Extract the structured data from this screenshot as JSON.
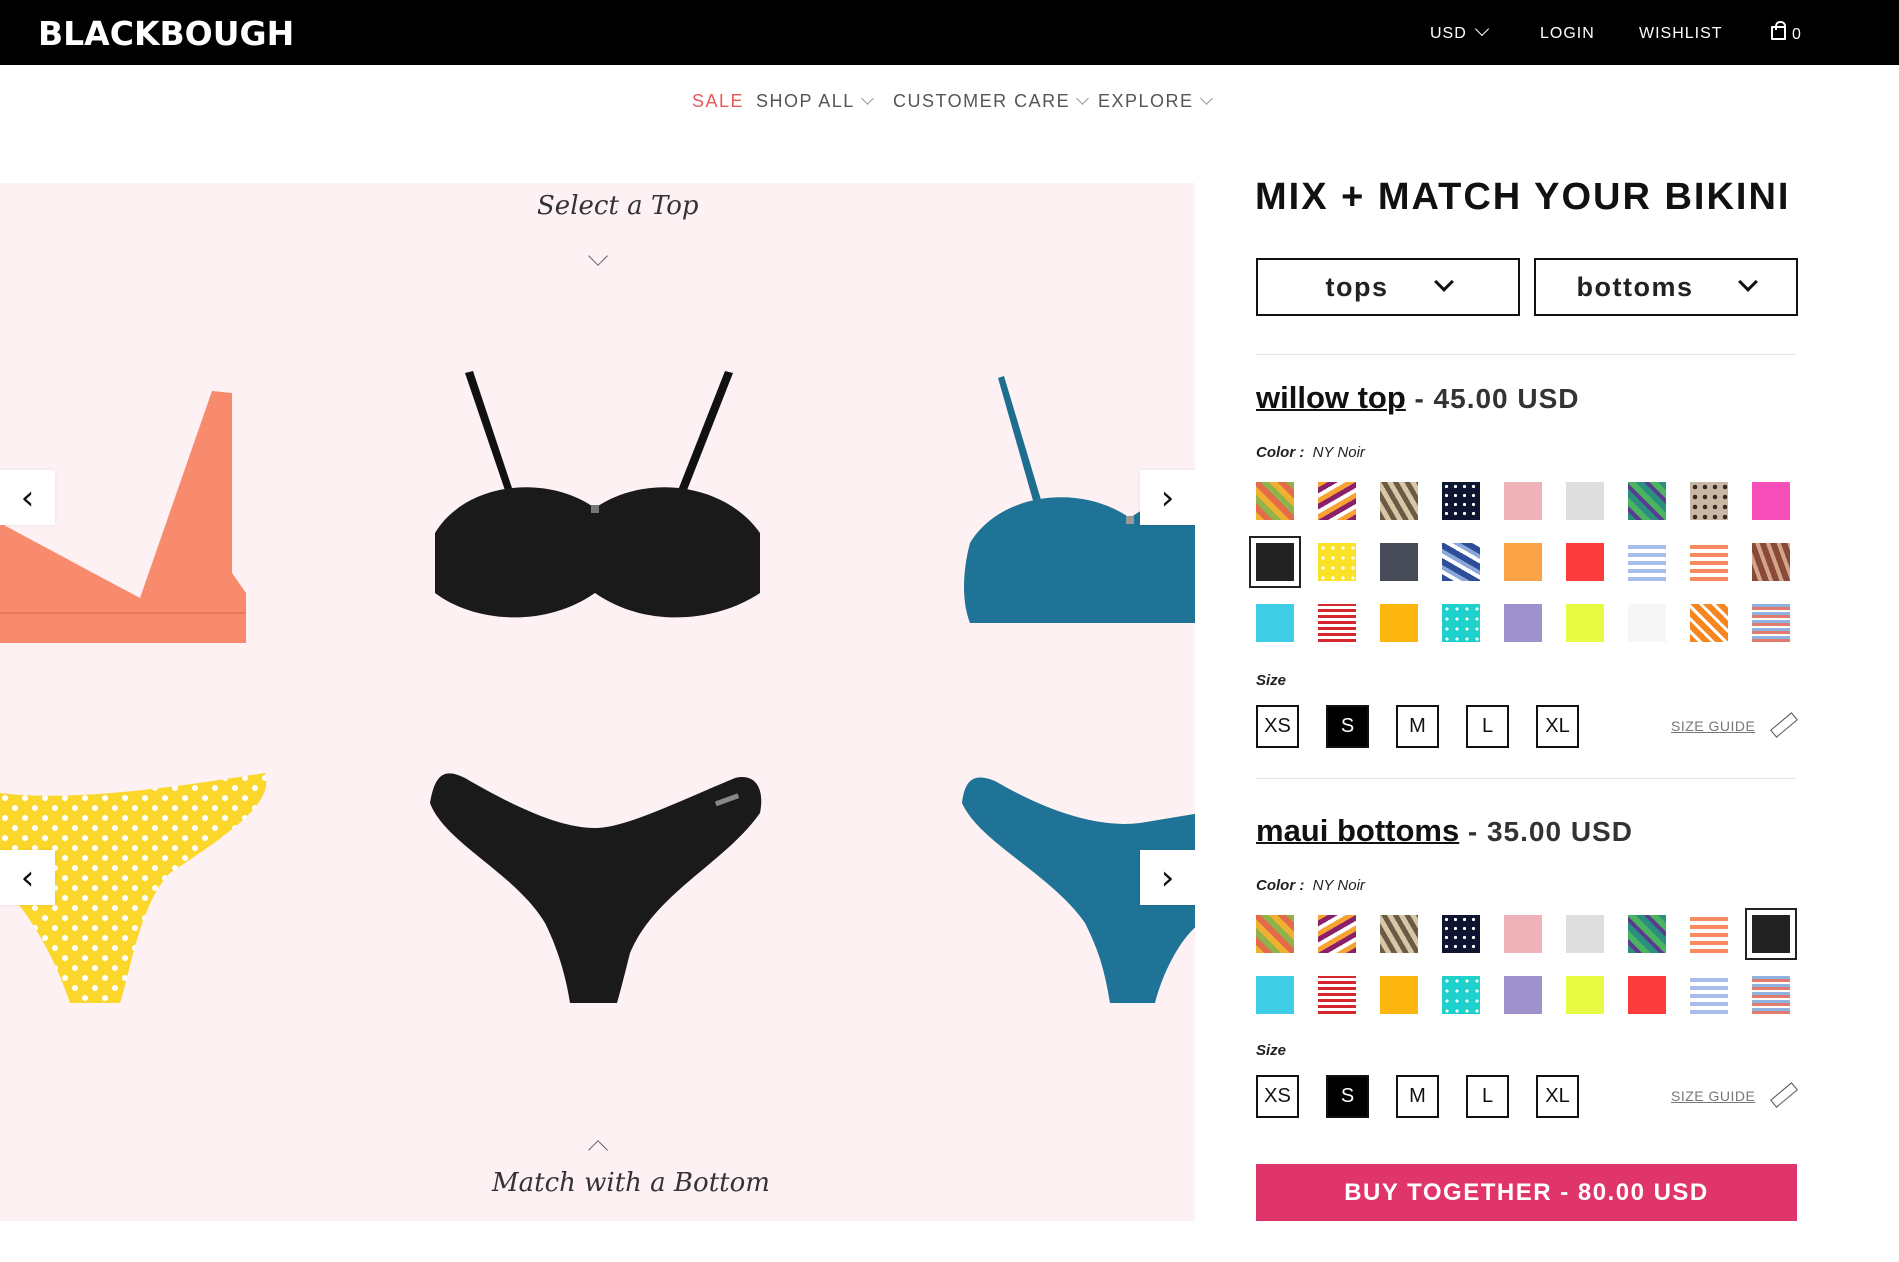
{
  "header": {
    "logo": "BLACKBOUGH",
    "currency": "USD",
    "login": "LOGIN",
    "wishlist": "WISHLIST",
    "cart_count": "0"
  },
  "subnav": {
    "sale": "SALE",
    "shop_all": "SHOP ALL",
    "customer_care": "CUSTOMER CARE",
    "explore": "EXPLORE"
  },
  "stage": {
    "select_top": "Select a Top",
    "match_bottom": "Match with a Bottom"
  },
  "panel": {
    "title": "MIX + MATCH YOUR BIKINI",
    "dropdown_tops": "tops",
    "dropdown_bottoms": "bottoms",
    "buy_label": "BUY TOGETHER - 80.00 USD"
  },
  "top_product": {
    "name": "willow top",
    "price": "45.00 USD",
    "color_label": "Color :",
    "color_value": "NY Noir",
    "size_label": "Size",
    "sizes": [
      "XS",
      "S",
      "M",
      "L",
      "XL"
    ],
    "selected_size": "S",
    "size_guide": "SIZE GUIDE"
  },
  "bottom_product": {
    "name": "maui bottoms",
    "price": "35.00 USD",
    "color_label": "Color :",
    "color_value": "NY Noir",
    "size_label": "Size",
    "sizes": [
      "XS",
      "S",
      "M",
      "L",
      "XL"
    ],
    "selected_size": "S",
    "size_guide": "SIZE GUIDE"
  },
  "colors": {
    "sale": "#e85a5a",
    "buy_button": "#e0356b",
    "stage_bg": "#fdf1f3"
  }
}
